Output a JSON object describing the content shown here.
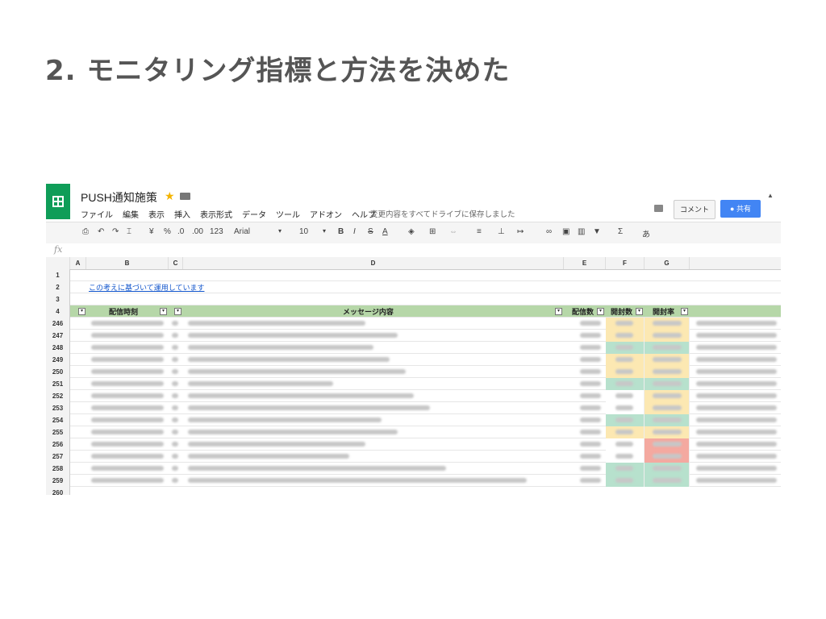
{
  "slide": {
    "title": "2. モニタリング指標と方法を決めた"
  },
  "app": {
    "doc_title": "PUSH通知施策",
    "menu": [
      "ファイル",
      "編集",
      "表示",
      "挿入",
      "表示形式",
      "データ",
      "ツール",
      "アドオン",
      "ヘルプ"
    ],
    "save_status": "変更内容をすべてドライブに保存しました",
    "comment_button": "コメント",
    "share_button": "共有"
  },
  "toolbar": {
    "currency": "¥",
    "percent": "%",
    "decimal_less": ".0",
    "decimal_more": ".00",
    "more_formats": "123",
    "font": "Arial",
    "font_size": "10",
    "bold": "B",
    "italic": "I",
    "strike": "S",
    "text_color": "A",
    "sigma": "Σ",
    "input_tools": "あ"
  },
  "formula_bar": {
    "fx": "fx"
  },
  "sheet": {
    "columns": [
      "A",
      "B",
      "C",
      "D",
      "E",
      "F",
      "G"
    ],
    "top_rows": [
      "1",
      "2",
      "3",
      "4"
    ],
    "link_text": "この考えに基づいて運用しています",
    "headers": {
      "b": "配信時刻",
      "d": "メッセージ内容",
      "e": "配信数",
      "f": "開封数",
      "g": "開封率"
    },
    "data_rows": [
      "246",
      "247",
      "248",
      "249",
      "250",
      "251",
      "252",
      "253",
      "254",
      "255",
      "256",
      "257",
      "258",
      "259",
      "260"
    ]
  },
  "colors": {
    "header_green": "#b6d7a8",
    "accent_blue": "#4285f4",
    "sheets_green": "#0f9d58",
    "cell_yellow": "#fce8b2",
    "cell_green": "#b7e1cd",
    "cell_red": "#f4a9a0"
  },
  "icons": [
    "sheets-logo-icon",
    "star-icon",
    "folder-icon",
    "comment-icon",
    "person-icon",
    "print-icon",
    "undo-icon",
    "redo-icon",
    "paint-format-icon",
    "fill-color-icon",
    "borders-icon",
    "merge-icon",
    "align-icon",
    "link-icon",
    "filter-icon",
    "functions-icon",
    "dropdown-icon"
  ]
}
